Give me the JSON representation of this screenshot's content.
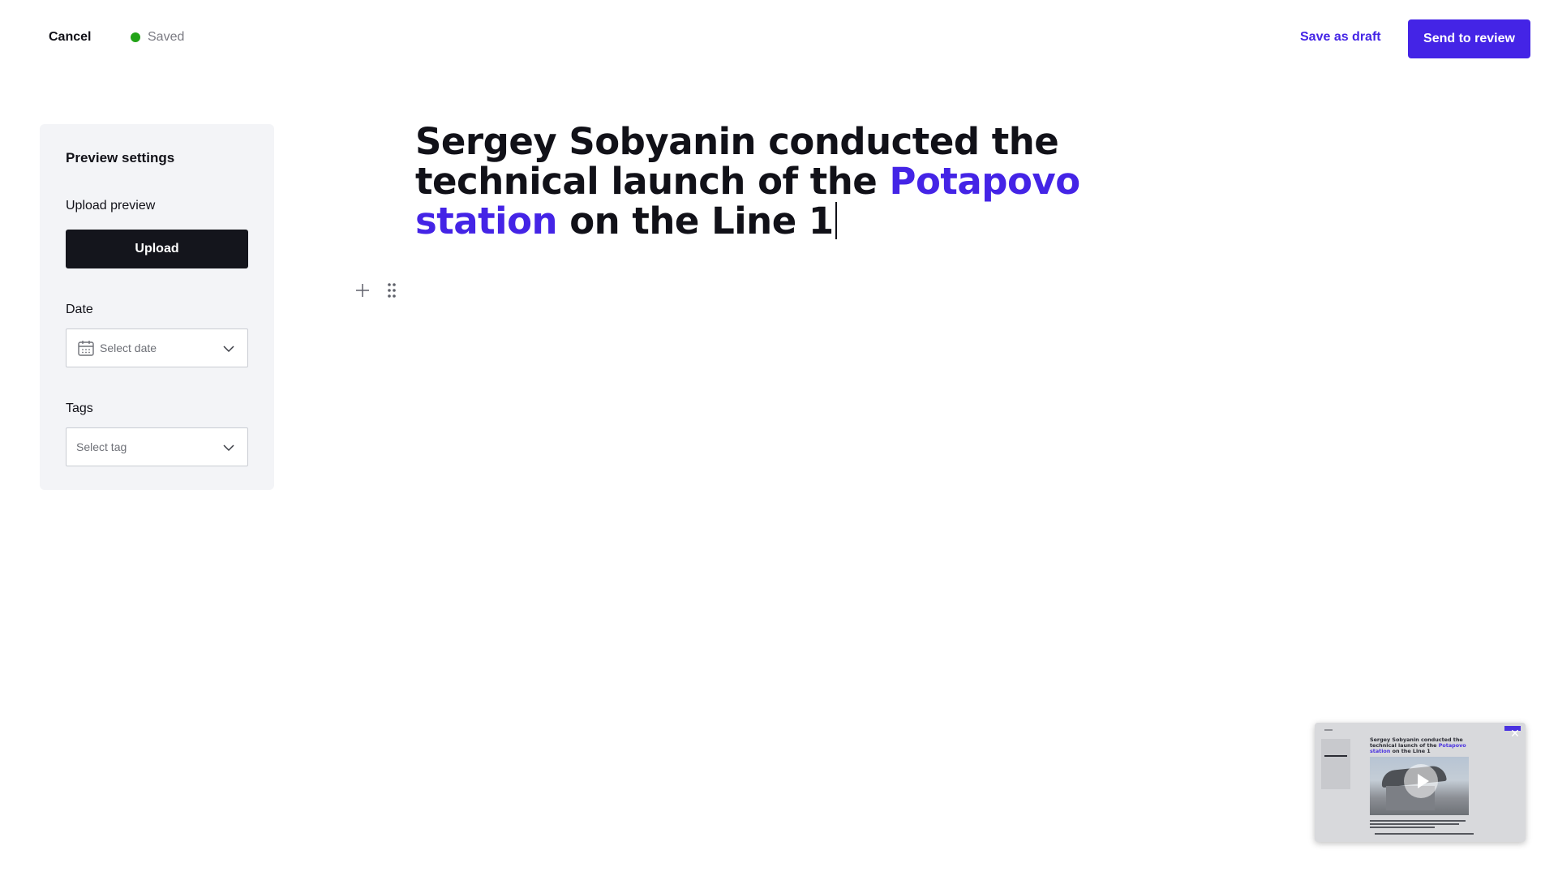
{
  "header": {
    "cancel_label": "Cancel",
    "saved_label": "Saved",
    "save_draft_label": "Save as draft",
    "send_review_label": "Send to review"
  },
  "sidebar": {
    "title": "Preview settings",
    "upload_label": "Upload preview",
    "upload_button": "Upload",
    "date_label": "Date",
    "date_placeholder": "Select date",
    "tags_label": "Tags",
    "tags_placeholder": "Select tag"
  },
  "editor": {
    "headline_part1": "Sergey Sobyanin conducted the technical launch of the ",
    "headline_highlight": "Potapovo station",
    "headline_part2": " on the Line 1"
  },
  "video": {
    "title_part1": "Sergey Sobyanin conducted the technical launch of the ",
    "title_highlight": "Potapovo station",
    "title_part2": " on the Line 1"
  },
  "colors": {
    "accent": "#4424e6",
    "saved_dot": "#22a317",
    "dark_button": "#14151c",
    "panel_bg": "#f3f4f7"
  },
  "icons": {
    "saved_indicator": "status-dot",
    "calendar": "calendar-icon",
    "chevron": "chevron-down-icon",
    "add_block": "plus-icon",
    "drag_handle": "drag-handle-icon",
    "play": "play-icon",
    "close": "close-icon"
  }
}
